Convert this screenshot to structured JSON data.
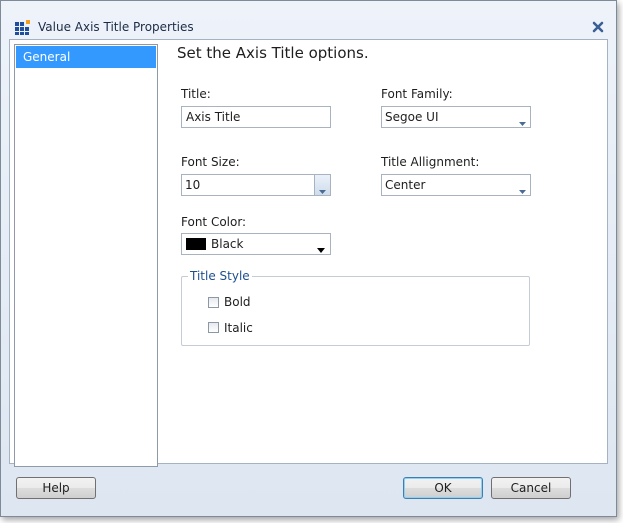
{
  "window": {
    "title": "Value Axis Title Properties"
  },
  "sidebar": {
    "items": [
      {
        "label": "General"
      }
    ]
  },
  "main": {
    "heading": "Set the Axis Title options.",
    "title_label": "Title:",
    "title_value": "Axis Title",
    "font_family_label": "Font Family:",
    "font_family_value": "Segoe UI",
    "font_size_label": "Font Size:",
    "font_size_value": "10",
    "alignment_label": "Title Allignment:",
    "alignment_value": "Center",
    "font_color_label": "Font Color:",
    "font_color_value": "Black",
    "font_color_swatch": "#000000",
    "title_style": {
      "legend": "Title Style",
      "bold_label": "Bold",
      "bold_checked": false,
      "italic_label": "Italic",
      "italic_checked": false
    }
  },
  "footer": {
    "help": "Help",
    "ok": "OK",
    "cancel": "Cancel"
  },
  "icons": {
    "app": "chart-grid-icon",
    "close": "close-icon"
  },
  "colors": {
    "selection": "#3399ff",
    "group_title": "#1d4f91"
  }
}
